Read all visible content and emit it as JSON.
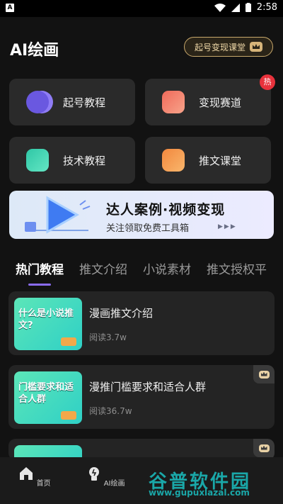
{
  "status": {
    "left_icon": "A",
    "time": "2:58"
  },
  "header": {
    "title": "AI绘画",
    "course_button": "起号变现课堂"
  },
  "cards": [
    {
      "label": "起号教程",
      "icon": "toggle-icon",
      "color": "#7f6cf0"
    },
    {
      "label": "变现赛道",
      "icon": "chart-card-icon",
      "color": "#f07a5e",
      "badge": "热"
    },
    {
      "label": "技术教程",
      "icon": "check-card-icon",
      "color": "#35d0b0"
    },
    {
      "label": "推文课堂",
      "icon": "star-bookmark-icon",
      "color": "#f49a4e"
    }
  ],
  "banner": {
    "title": "达人案例·视频变现",
    "subtitle": "关注领取免费工具箱"
  },
  "tabs": [
    "热门教程",
    "推文介绍",
    "小说素材",
    "推文授权平"
  ],
  "items": [
    {
      "thumb_text": "什么是小说推文?",
      "title": "漫画推文介绍",
      "reads": "阅读3.7w",
      "vip": false
    },
    {
      "thumb_text": "门槛要求和适合人群",
      "title": "漫推门槛要求和适合人群",
      "reads": "阅读36.7w",
      "vip": true
    },
    {
      "thumb_text": "",
      "title": "",
      "reads": "",
      "vip": true
    }
  ],
  "nav": [
    {
      "label": "首页",
      "icon": "home-icon"
    },
    {
      "label": "AI绘画",
      "icon": "bulb-icon"
    }
  ],
  "watermark": {
    "cn": "谷普软件园",
    "url": "www.gupuxlazal.com"
  }
}
